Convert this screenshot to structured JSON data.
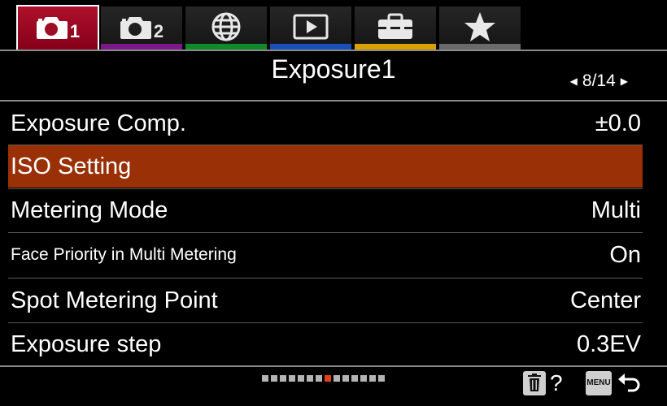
{
  "tabs": [
    {
      "id": "shoot1",
      "icon": "camera-icon",
      "num": "1",
      "stripe": "#c8102e",
      "active": true
    },
    {
      "id": "shoot2",
      "icon": "camera-icon",
      "num": "2",
      "stripe": "#7a1a8a",
      "active": false
    },
    {
      "id": "network",
      "icon": "globe-icon",
      "num": "",
      "stripe": "#0e8a2a",
      "active": false
    },
    {
      "id": "playback",
      "icon": "play-icon",
      "num": "",
      "stripe": "#1a4fb8",
      "active": false
    },
    {
      "id": "setup",
      "icon": "toolbox-icon",
      "num": "",
      "stripe": "#d8a000",
      "active": false
    },
    {
      "id": "mymenu",
      "icon": "star-icon",
      "num": "",
      "stripe": "#6a6a6a",
      "active": false
    }
  ],
  "header": {
    "title": "Exposure1",
    "page": "8/14"
  },
  "rows": [
    {
      "label": "Exposure Comp.",
      "value": "±0.0",
      "selected": false,
      "small": false
    },
    {
      "label": "ISO Setting",
      "value": "",
      "selected": true,
      "small": false
    },
    {
      "label": "Metering Mode",
      "value": "Multi",
      "selected": false,
      "small": false
    },
    {
      "label": "Face Priority in Multi Metering",
      "value": "On",
      "selected": false,
      "small": true
    },
    {
      "label": "Spot Metering Point",
      "value": "Center",
      "selected": false,
      "small": false
    },
    {
      "label": "Exposure step",
      "value": "0.3EV",
      "selected": false,
      "small": false
    }
  ],
  "page_indicator": {
    "total": 14,
    "current": 8
  },
  "footer": {
    "help_label": "?",
    "menu_label": "MENU"
  },
  "colors": {
    "active_tab": "#b0102c",
    "selection": "#9a3005",
    "current_dot": "#e0401c"
  }
}
